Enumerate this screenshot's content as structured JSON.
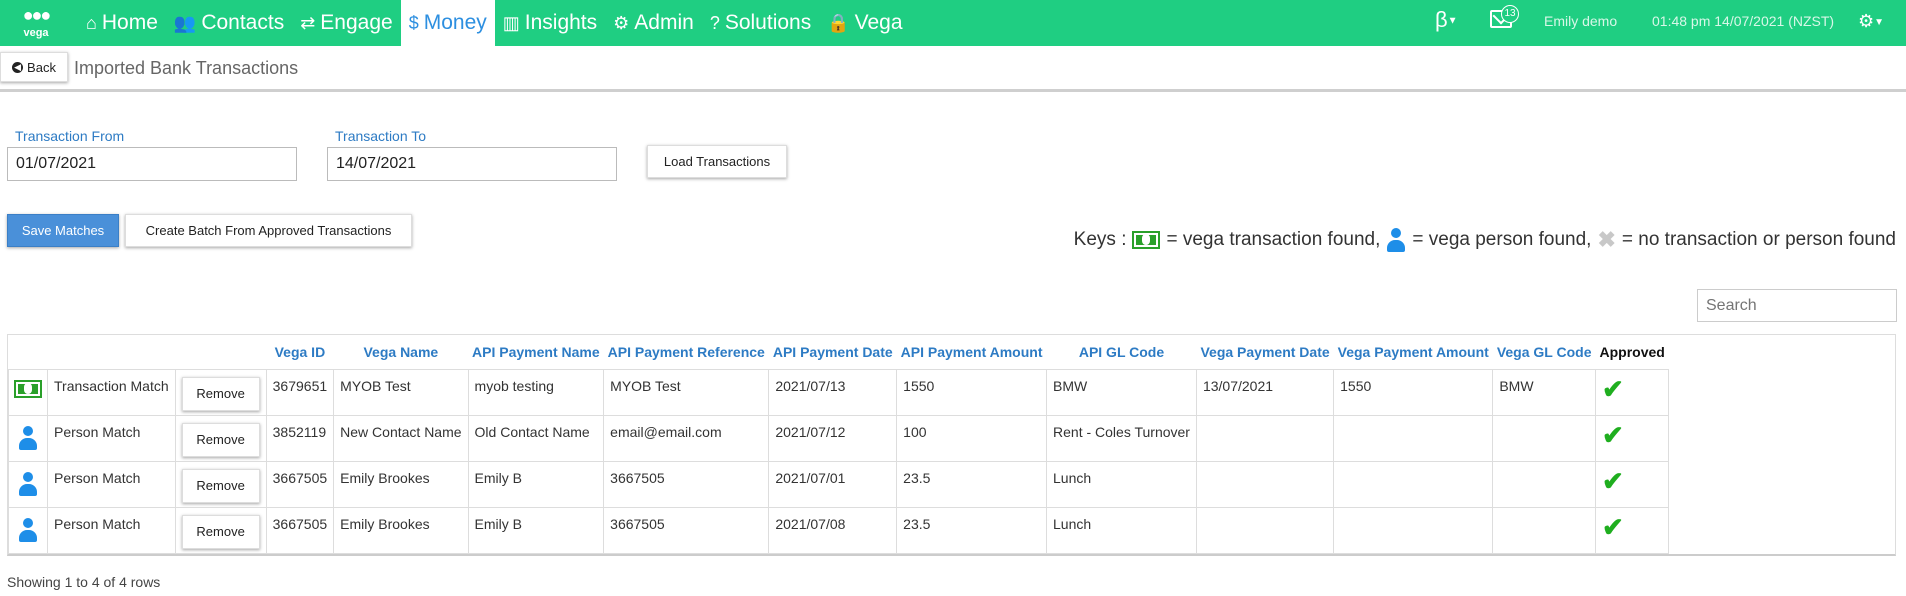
{
  "brand": {
    "logo_text": "vega",
    "accent": "#1fce82",
    "link_color": "#2d7bc4"
  },
  "nav": [
    {
      "label": "Home",
      "icon": "home-icon",
      "glyph": "⌂",
      "active": false
    },
    {
      "label": "Contacts",
      "icon": "users-icon",
      "glyph": "👥",
      "active": false
    },
    {
      "label": "Engage",
      "icon": "exchange-icon",
      "glyph": "⇄",
      "active": false
    },
    {
      "label": "Money",
      "icon": "dollar-icon",
      "glyph": "$",
      "active": true
    },
    {
      "label": "Insights",
      "icon": "bar-chart-icon",
      "glyph": "▥",
      "active": false
    },
    {
      "label": "Admin",
      "icon": "cogs-icon",
      "glyph": "⚙",
      "active": false
    },
    {
      "label": "Solutions",
      "icon": "question-icon",
      "glyph": "?",
      "active": false
    },
    {
      "label": "Vega",
      "icon": "lock-icon",
      "glyph": "🔒",
      "active": false
    }
  ],
  "topright": {
    "beta": "β",
    "mail_count": "13",
    "user": "Emily demo",
    "datetime": "01:48 pm 14/07/2021 (NZST)"
  },
  "subheader": {
    "back_label": "Back",
    "title": "Imported Bank Transactions"
  },
  "filters": {
    "from_label": "Transaction From",
    "from_value": "01/07/2021",
    "to_label": "Transaction To",
    "to_value": "14/07/2021",
    "load_label": "Load Transactions"
  },
  "actions": {
    "save_label": "Save Matches",
    "batch_label": "Create Batch From Approved Transactions"
  },
  "keys": {
    "prefix": "Keys :",
    "transaction": "= vega transaction found,",
    "person": "= vega person found,",
    "none": "= no transaction or person found"
  },
  "search": {
    "placeholder": "Search"
  },
  "table": {
    "headers": [
      "",
      "",
      "",
      "Vega ID",
      "Vega Name",
      "API Payment Name",
      "API Payment Reference",
      "API Payment Date",
      "API Payment Amount",
      "API GL Code",
      "Vega Payment Date",
      "Vega Payment Amount",
      "Vega GL Code",
      "Approved"
    ],
    "remove_label": "Remove",
    "rows": [
      {
        "icon": "money",
        "match": "Transaction Match",
        "vega_id": "3679651",
        "vega_name": "MYOB Test",
        "api_name": "myob testing",
        "api_ref": "MYOB Test",
        "api_date": "2021/07/13",
        "api_amount": "1550",
        "api_gl": "BMW",
        "vega_date": "13/07/2021",
        "vega_amount": "1550",
        "vega_gl": "BMW",
        "approved": true
      },
      {
        "icon": "person",
        "match": "Person Match",
        "vega_id": "3852119",
        "vega_name": "New Contact Name",
        "api_name": "Old Contact Name",
        "api_ref": "email@email.com",
        "api_date": "2021/07/12",
        "api_amount": "100",
        "api_gl": "Rent - Coles Turnover",
        "vega_date": "",
        "vega_amount": "",
        "vega_gl": "",
        "approved": true
      },
      {
        "icon": "person",
        "match": "Person Match",
        "vega_id": "3667505",
        "vega_name": "Emily Brookes",
        "api_name": "Emily B",
        "api_ref": "3667505",
        "api_date": "2021/07/01",
        "api_amount": "23.5",
        "api_gl": "Lunch",
        "vega_date": "",
        "vega_amount": "",
        "vega_gl": "",
        "approved": true
      },
      {
        "icon": "person",
        "match": "Person Match",
        "vega_id": "3667505",
        "vega_name": "Emily Brookes",
        "api_name": "Emily B",
        "api_ref": "3667505",
        "api_date": "2021/07/08",
        "api_amount": "23.5",
        "api_gl": "Lunch",
        "vega_date": "",
        "vega_amount": "",
        "vega_gl": "",
        "approved": true
      }
    ]
  },
  "footer": "Showing 1 to 4 of 4 rows"
}
